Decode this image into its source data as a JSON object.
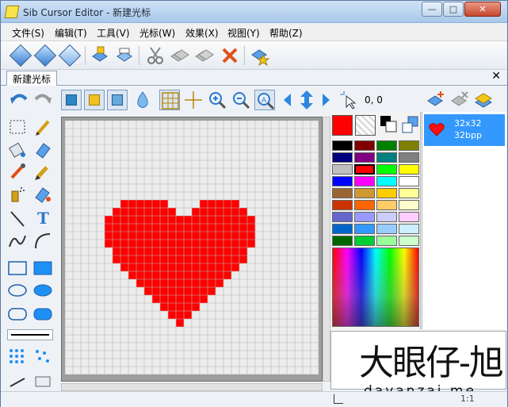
{
  "window": {
    "title": "Sib Cursor Editor - 新建光标",
    "controls": {
      "minimize": "—",
      "maximize": "□",
      "close": "✕"
    }
  },
  "menu": [
    "文件(S)",
    "编辑(T)",
    "工具(V)",
    "光标(W)",
    "效果(X)",
    "视图(Y)",
    "帮助(Z)"
  ],
  "toolbar": {
    "buttons": [
      "new-gem-icon",
      "open-gem-icon",
      "save-gem-icon",
      "import-icon",
      "export-icon",
      "cut-icon",
      "copy-icon",
      "paste-icon",
      "delete-icon",
      "wizard-icon"
    ]
  },
  "tab": {
    "label": "新建光标",
    "close": "✕"
  },
  "edit_toolbar": {
    "coords": "0, 0"
  },
  "left_tools": {
    "text_tool": "T"
  },
  "colors": {
    "primary": "#ff0000",
    "palette": [
      [
        "#000000",
        "#800000",
        "#008000",
        "#808000"
      ],
      [
        "#000080",
        "#800080",
        "#008080",
        "#808080"
      ],
      [
        "#c0c0c0",
        "#ff0000",
        "#00ff00",
        "#ffff00"
      ],
      [
        "#0000ff",
        "#ff00ff",
        "#00ffff",
        "#ffffff"
      ],
      [
        "#996633",
        "#cc9933",
        "#ffcc00",
        "#ffff99"
      ],
      [
        "#cc3300",
        "#ff6600",
        "#ffcc66",
        "#ffffcc"
      ],
      [
        "#6666cc",
        "#9999ff",
        "#ccccff",
        "#ffccff"
      ],
      [
        "#0066cc",
        "#3399ff",
        "#99ccff",
        "#cceeff"
      ],
      [
        "#006600",
        "#00cc33",
        "#99ff99",
        "#ccffcc"
      ]
    ],
    "selected_index": [
      2,
      1
    ]
  },
  "cursor_list": {
    "items": [
      {
        "size": "32x32",
        "depth": "32bpp"
      }
    ]
  },
  "canvas": {
    "grid_size": 32,
    "heart_rows": [
      [],
      [],
      [],
      [],
      [],
      [],
      [],
      [],
      [],
      [],
      [
        7,
        8,
        9,
        10,
        11,
        12,
        17,
        18,
        19,
        20,
        21
      ],
      [
        6,
        7,
        8,
        9,
        10,
        11,
        12,
        13,
        16,
        17,
        18,
        19,
        20,
        21,
        22
      ],
      [
        5,
        6,
        7,
        8,
        9,
        10,
        11,
        12,
        13,
        14,
        15,
        16,
        17,
        18,
        19,
        20,
        21,
        22,
        23
      ],
      [
        5,
        6,
        7,
        8,
        9,
        10,
        11,
        12,
        13,
        14,
        15,
        16,
        17,
        18,
        19,
        20,
        21,
        22,
        23
      ],
      [
        5,
        6,
        7,
        8,
        9,
        10,
        11,
        12,
        13,
        14,
        15,
        16,
        17,
        18,
        19,
        20,
        21,
        22,
        23
      ],
      [
        5,
        6,
        7,
        8,
        9,
        10,
        11,
        12,
        13,
        14,
        15,
        16,
        17,
        18,
        19,
        20,
        21,
        22,
        23
      ],
      [
        6,
        7,
        8,
        9,
        10,
        11,
        12,
        13,
        14,
        15,
        16,
        17,
        18,
        19,
        20,
        21,
        22
      ],
      [
        6,
        7,
        8,
        9,
        10,
        11,
        12,
        13,
        14,
        15,
        16,
        17,
        18,
        19,
        20,
        21,
        22
      ],
      [
        7,
        8,
        9,
        10,
        11,
        12,
        13,
        14,
        15,
        16,
        17,
        18,
        19,
        20,
        21
      ],
      [
        8,
        9,
        10,
        11,
        12,
        13,
        14,
        15,
        16,
        17,
        18,
        19,
        20
      ],
      [
        9,
        10,
        11,
        12,
        13,
        14,
        15,
        16,
        17,
        18,
        19
      ],
      [
        10,
        11,
        12,
        13,
        14,
        15,
        16,
        17,
        18
      ],
      [
        11,
        12,
        13,
        14,
        15,
        16,
        17
      ],
      [
        12,
        13,
        14,
        15,
        16
      ],
      [
        13,
        14,
        15
      ],
      [
        14
      ],
      [],
      [],
      [],
      [],
      [],
      []
    ]
  },
  "watermark": {
    "chars": "大眼仔-旭",
    "latin": "dayanzai.me"
  },
  "status": {
    "text": "1:1"
  }
}
